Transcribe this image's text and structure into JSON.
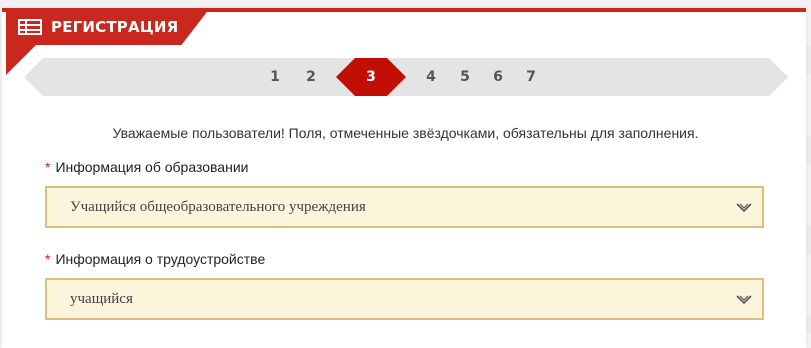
{
  "header": {
    "title": "РЕГИСТРАЦИЯ",
    "icon": "register-icon",
    "accent": "#c8281e"
  },
  "stepper": {
    "steps": [
      "1",
      "2",
      "3",
      "4",
      "5",
      "6",
      "7"
    ],
    "active": "3"
  },
  "notice": "Уважаемые пользователи! Поля, отмеченные звёздочками, обязательны для заполнения.",
  "fields": [
    {
      "required_mark": "*",
      "label": "Информация об образовании",
      "value": "Учащийся общеобразовательного учреждения"
    },
    {
      "required_mark": "*",
      "label": "Информация о трудоустройстве",
      "value": "учащийся"
    }
  ]
}
